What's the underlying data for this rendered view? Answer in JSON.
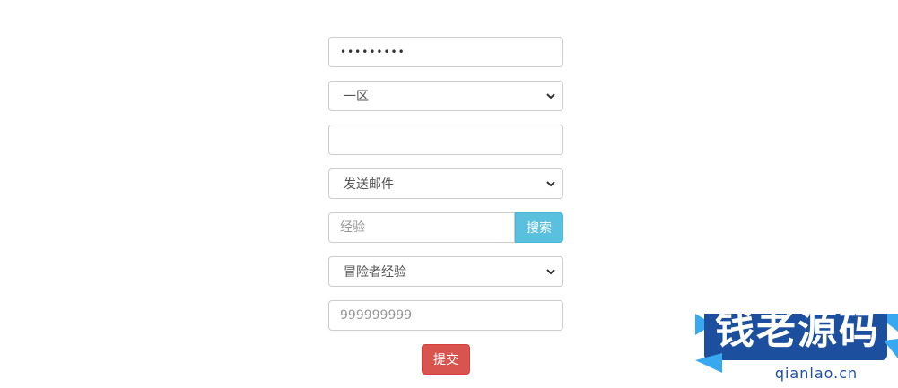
{
  "form": {
    "password_value": "•••••••••",
    "district_select": "一区",
    "empty_field_value": "",
    "action_select": "发送邮件",
    "search_placeholder": "经验",
    "search_button_label": "搜索",
    "category_select": "冒险者经验",
    "number_placeholder": "999999999",
    "submit_label": "提交"
  },
  "watermark": {
    "title": "钱老源码",
    "domain": "qianlao.cn"
  },
  "colors": {
    "info_button": "#5bc0de",
    "danger_button": "#d9534f",
    "watermark_blue": "#1d4f9f"
  },
  "icons": {
    "select_arrow": "chevron-down-icon"
  }
}
